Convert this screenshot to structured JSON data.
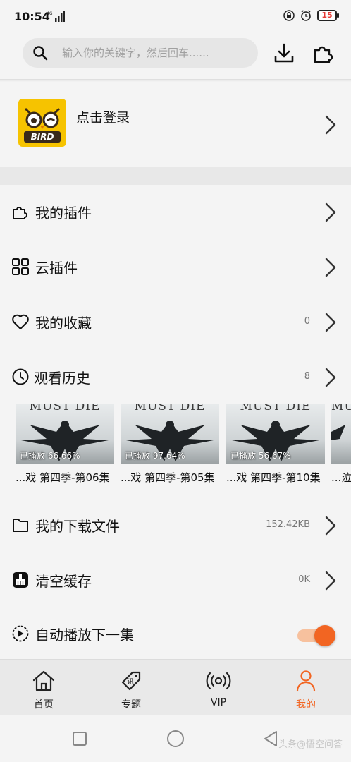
{
  "status": {
    "time": "10:54",
    "network": "4G",
    "battery": "15"
  },
  "search": {
    "placeholder": "输入你的关键字，然后回车......"
  },
  "login": {
    "label": "点击登录",
    "logo_text": "BIRD"
  },
  "menu": [
    {
      "label": "我的插件",
      "value": ""
    },
    {
      "label": "云插件",
      "value": ""
    },
    {
      "label": "我的收藏",
      "value": "0"
    },
    {
      "label": "观看历史",
      "value": "8"
    },
    {
      "label": "我的下载文件",
      "value": "152.42KB"
    },
    {
      "label": "清空缓存",
      "value": "0K"
    },
    {
      "label": "自动播放下一集",
      "value": ""
    }
  ],
  "history": [
    {
      "poster_text": "MUST DIE",
      "progress": "已播放 66.66%",
      "title": "...戏 第四季-第06集"
    },
    {
      "poster_text": "MUST DIE",
      "progress": "已播放 97.64%",
      "title": "...戏 第四季-第05集"
    },
    {
      "poster_text": "MUST DIE",
      "progress": "已播放 56.67%",
      "title": "...戏 第四季-第10集"
    },
    {
      "poster_text": "MUST DIE",
      "progress": "",
      "title": "...泣"
    }
  ],
  "autoplay": {
    "enabled": true
  },
  "bottom_nav": [
    {
      "label": "首页",
      "icon": "home-icon",
      "active": false
    },
    {
      "label": "专题",
      "icon": "tag-icon",
      "active": false
    },
    {
      "label": "VIP",
      "icon": "broadcast-icon",
      "active": false
    },
    {
      "label": "我的",
      "icon": "person-icon",
      "active": true
    }
  ],
  "watermark": "头条@悟空问答",
  "colors": {
    "accent": "#f26522",
    "logo_bg": "#f6c300",
    "battery_low": "#e53935"
  }
}
